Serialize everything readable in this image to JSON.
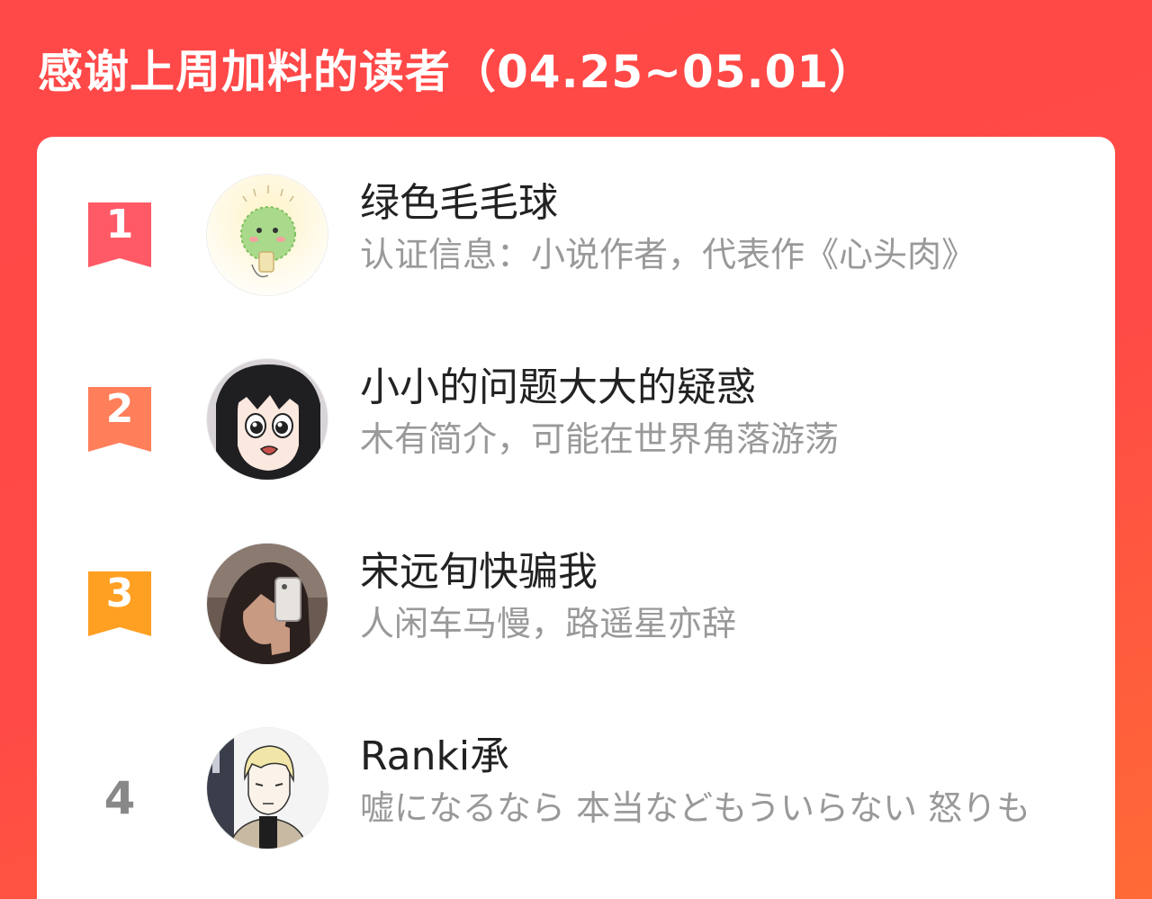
{
  "header": {
    "title": "感谢上周加料的读者（04.25~05.01）"
  },
  "colors": {
    "background_start": "#ff4848",
    "background_end": "#ff6a36",
    "rank_1": "#ff5a66",
    "rank_2": "#ff7f5a",
    "rank_3": "#ffa023",
    "rank_plain": "#888888",
    "name_text": "#222222",
    "bio_text": "#999999"
  },
  "readers": [
    {
      "rank": "1",
      "name": "绿色毛毛球",
      "bio": "认证信息：小说作者，代表作《心头肉》",
      "avatar_icon": "green-furball-cartoon-avatar"
    },
    {
      "rank": "2",
      "name": "小小的问题大大的疑惑",
      "bio": "木有简介，可能在世界角落游荡",
      "avatar_icon": "anime-girl-black-hair-avatar"
    },
    {
      "rank": "3",
      "name": "宋远旬快骗我",
      "bio": "人闲车马慢，路遥星亦辞",
      "avatar_icon": "mirror-selfie-photo-avatar"
    },
    {
      "rank": "4",
      "name": "Ranki承",
      "bio": "嘘になるなら 本当などもういらない 怒りも",
      "avatar_icon": "blonde-anime-boy-avatar"
    }
  ]
}
